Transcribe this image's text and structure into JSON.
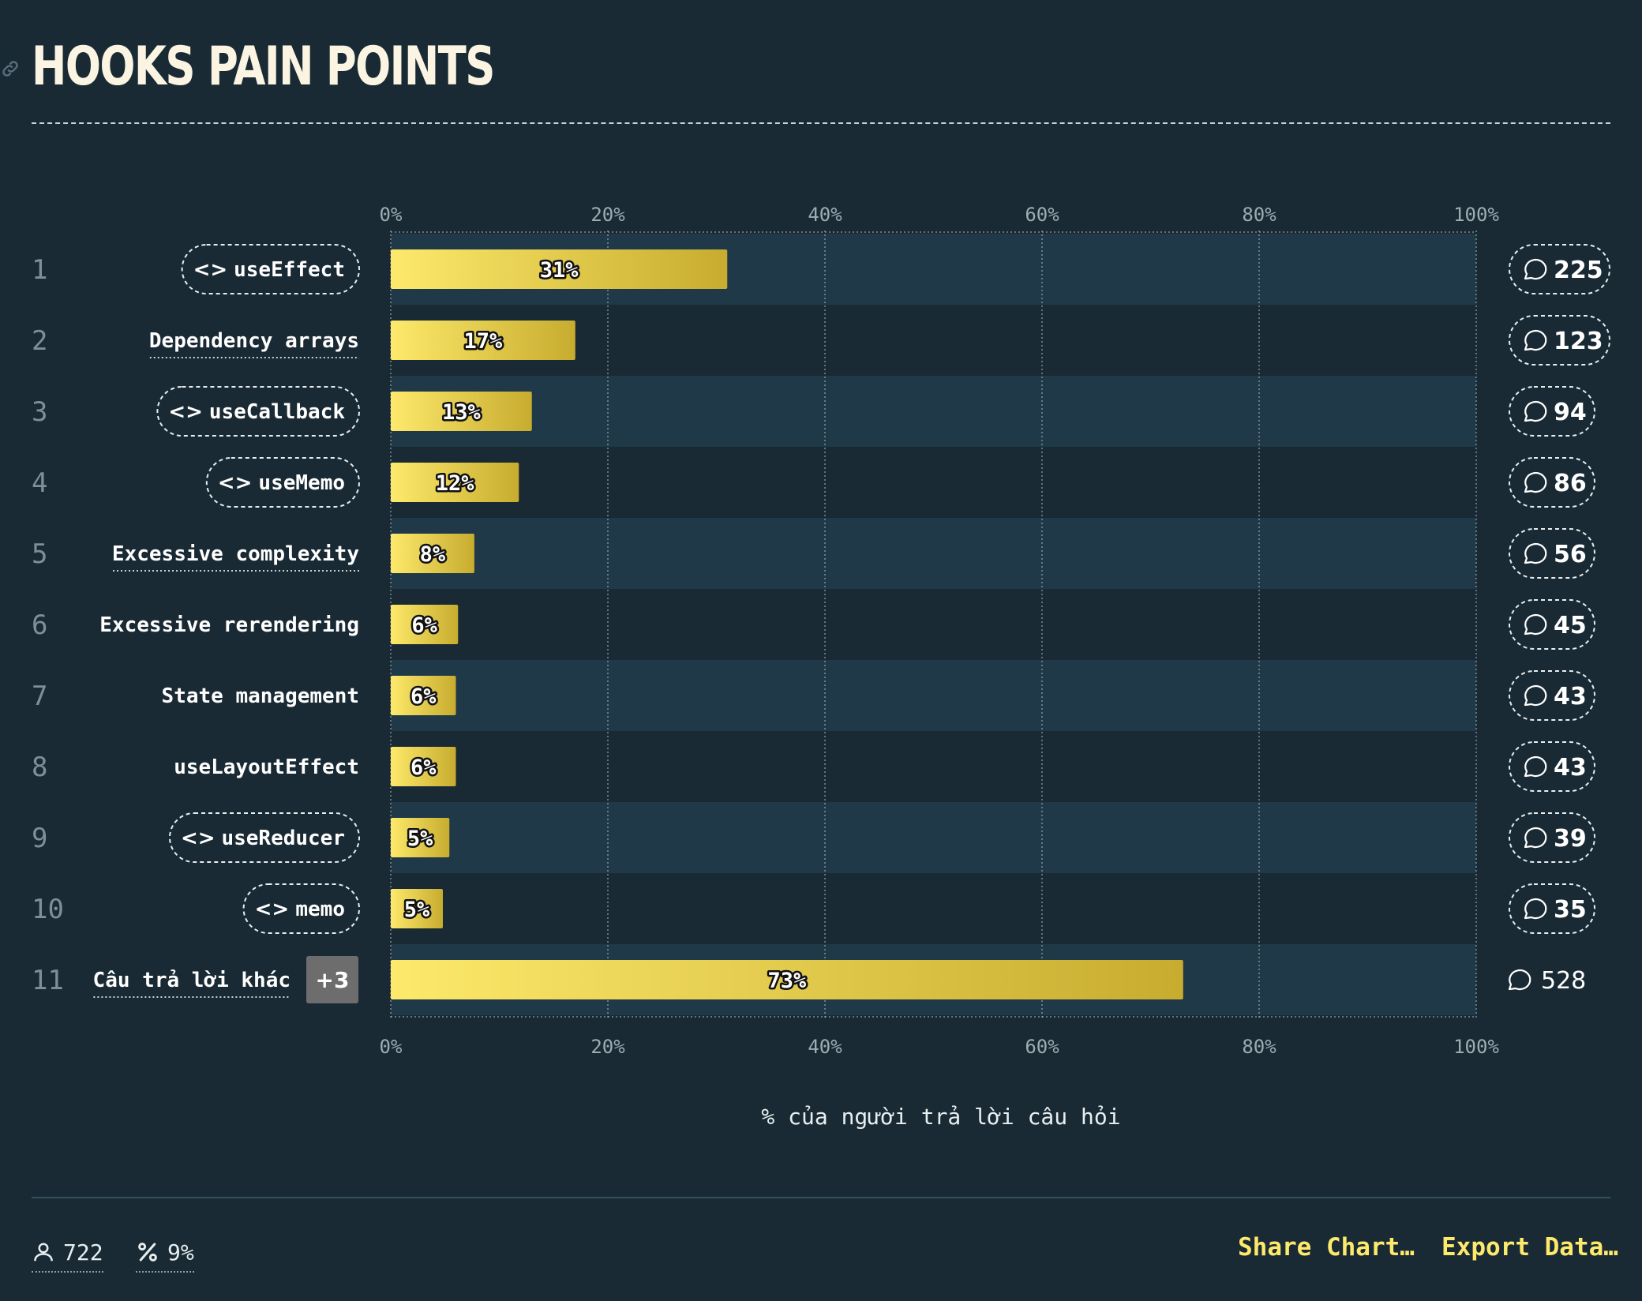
{
  "title": "HOOKS PAIN POINTS",
  "footer": {
    "respondents": "722",
    "percentage": "9%",
    "share_label": "Share Chart…",
    "export_label": "Export Data…"
  },
  "colors": {
    "background": "#192a34",
    "bar_start": "#fde96b",
    "bar_end": "#c7ac2f",
    "band": "#203948",
    "grid": "#a7b4ba",
    "accent": "#fde96b"
  },
  "chart_data": {
    "type": "bar",
    "orientation": "horizontal",
    "xlabel": "% của người trả lời câu hỏi",
    "xlim": [
      0,
      100
    ],
    "xticks": [
      "0%",
      "20%",
      "40%",
      "60%",
      "80%",
      "100%"
    ],
    "grid": true,
    "rows": [
      {
        "rank": "1",
        "label": "useEffect",
        "code": true,
        "value": 31,
        "value_label": "31%",
        "count": "225"
      },
      {
        "rank": "2",
        "label": "Dependency arrays",
        "code": false,
        "underline": true,
        "value": 17,
        "value_label": "17%",
        "count": "123"
      },
      {
        "rank": "3",
        "label": "useCallback",
        "code": true,
        "value": 13,
        "value_label": "13%",
        "count": "94"
      },
      {
        "rank": "4",
        "label": "useMemo",
        "code": true,
        "value": 11.8,
        "value_label": "12%",
        "count": "86"
      },
      {
        "rank": "5",
        "label": "Excessive complexity",
        "code": false,
        "underline": true,
        "value": 7.7,
        "value_label": "8%",
        "count": "56"
      },
      {
        "rank": "6",
        "label": "Excessive rerendering",
        "code": false,
        "underline": false,
        "value": 6.2,
        "value_label": "6%",
        "count": "45"
      },
      {
        "rank": "7",
        "label": "State management",
        "code": false,
        "underline": false,
        "value": 6,
        "value_label": "6%",
        "count": "43"
      },
      {
        "rank": "8",
        "label": "useLayoutEffect",
        "code": false,
        "underline": false,
        "value": 6,
        "value_label": "6%",
        "count": "43"
      },
      {
        "rank": "9",
        "label": "useReducer",
        "code": true,
        "value": 5.4,
        "value_label": "5%",
        "count": "39"
      },
      {
        "rank": "10",
        "label": "memo",
        "code": true,
        "value": 4.8,
        "value_label": "5%",
        "count": "35"
      },
      {
        "rank": "11",
        "label": "Câu trả lời khác",
        "code": false,
        "underline": true,
        "extra": "+3",
        "value": 73,
        "value_label": "73%",
        "count": "528",
        "plain_count": true
      }
    ]
  }
}
